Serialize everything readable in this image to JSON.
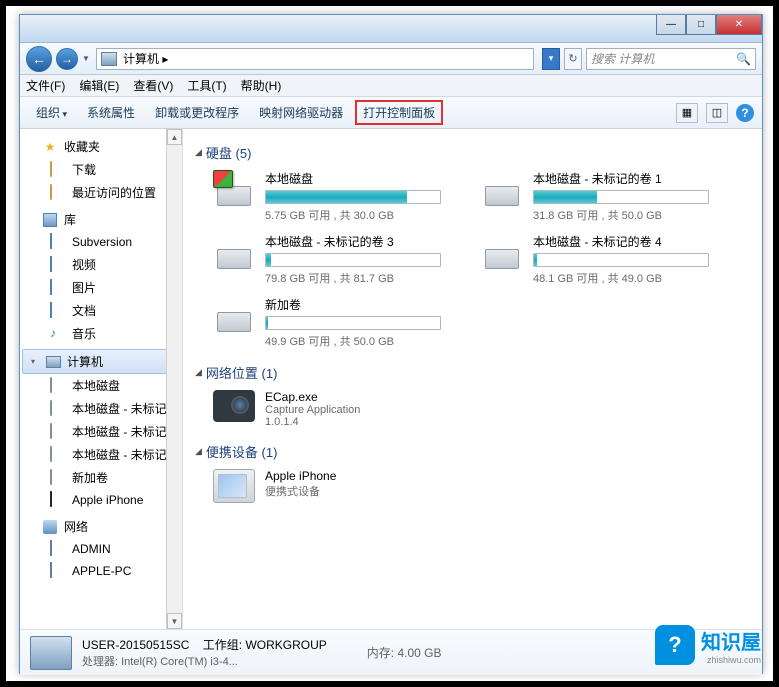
{
  "window": {
    "min": "—",
    "max": "□",
    "close": "✕"
  },
  "address": {
    "icon_label": "computer-icon",
    "path": "计算机 ▸",
    "dropdown": "▾",
    "refresh": "↻"
  },
  "search": {
    "placeholder": "搜索 计算机",
    "icon": "🔍"
  },
  "menubar": {
    "file": "文件(F)",
    "edit": "编辑(E)",
    "view": "查看(V)",
    "tools": "工具(T)",
    "help": "帮助(H)"
  },
  "toolbar": {
    "organize": "组织",
    "sys_props": "系统属性",
    "uninstall": "卸载或更改程序",
    "map_drive": "映射网络驱动器",
    "control_panel": "打开控制面板",
    "view_icon": "▦",
    "pane_icon": "◫",
    "help": "?"
  },
  "sidebar": {
    "favorites": {
      "label": "收藏夹",
      "items": [
        {
          "label": "下载",
          "icon": "download-icon"
        },
        {
          "label": "最近访问的位置",
          "icon": "recent-icon"
        }
      ]
    },
    "libraries": {
      "label": "库",
      "items": [
        {
          "label": "Subversion",
          "icon": "subversion-icon"
        },
        {
          "label": "视频",
          "icon": "video-icon"
        },
        {
          "label": "图片",
          "icon": "pictures-icon"
        },
        {
          "label": "文档",
          "icon": "documents-icon"
        },
        {
          "label": "音乐",
          "icon": "music-icon"
        }
      ]
    },
    "computer": {
      "label": "计算机",
      "items": [
        {
          "label": "本地磁盘",
          "icon": "drive-icon"
        },
        {
          "label": "本地磁盘 - 未标记的卷",
          "icon": "drive-icon"
        },
        {
          "label": "本地磁盘 - 未标记的卷",
          "icon": "drive-icon"
        },
        {
          "label": "本地磁盘 - 未标记的卷",
          "icon": "drive-icon"
        },
        {
          "label": "新加卷",
          "icon": "drive-icon"
        },
        {
          "label": "Apple iPhone",
          "icon": "iphone-icon"
        }
      ]
    },
    "network": {
      "label": "网络",
      "items": [
        {
          "label": "ADMIN",
          "icon": "pc-icon"
        },
        {
          "label": "APPLE-PC",
          "icon": "pc-icon"
        }
      ]
    }
  },
  "sections": {
    "drives": {
      "label": "硬盘 (5)"
    },
    "netloc": {
      "label": "网络位置 (1)"
    },
    "portable": {
      "label": "便携设备 (1)"
    }
  },
  "drives": [
    {
      "name": "本地磁盘",
      "free": "5.75 GB",
      "total": "30.0 GB",
      "fill_pct": 81,
      "emblem": "win"
    },
    {
      "name": "本地磁盘 - 未标记的卷 1",
      "free": "31.8 GB",
      "total": "50.0 GB",
      "fill_pct": 36,
      "emblem": ""
    },
    {
      "name": "本地磁盘 - 未标记的卷 3",
      "free": "79.8 GB",
      "total": "81.7 GB",
      "fill_pct": 3,
      "emblem": ""
    },
    {
      "name": "本地磁盘 - 未标记的卷 4",
      "free": "48.1 GB",
      "total": "49.0 GB",
      "fill_pct": 2,
      "emblem": ""
    },
    {
      "name": "新加卷",
      "free": "49.9 GB",
      "total": "50.0 GB",
      "fill_pct": 1,
      "emblem": ""
    }
  ],
  "drive_stats_tpl": {
    "sep": " 可用 , 共 "
  },
  "netloc": {
    "name": "ECap.exe",
    "sub1": "Capture Application",
    "sub2": "1.0.1.4"
  },
  "portable": {
    "name": "Apple iPhone",
    "sub": "便携式设备"
  },
  "details": {
    "name": "USER-20150515SC",
    "workgroup_label": "工作组:",
    "workgroup": "WORKGROUP",
    "mem_label": "内存:",
    "mem": "4.00 GB",
    "cpu_label": "处理器:",
    "cpu": "Intel(R) Core(TM) i3-4..."
  },
  "watermark": {
    "badge": "?",
    "text": "知识屋",
    "sub": "zhishiwu.com"
  }
}
